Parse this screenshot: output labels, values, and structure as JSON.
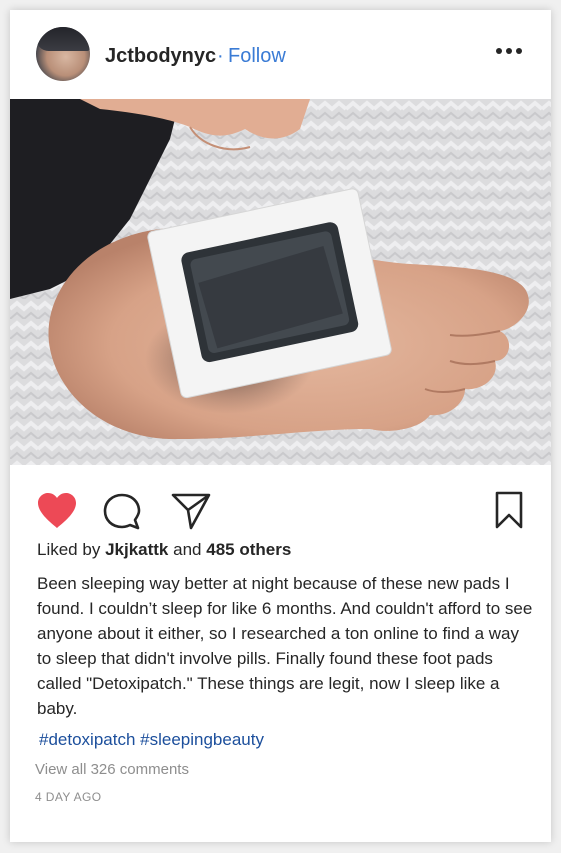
{
  "post": {
    "username": "Jctbodynyc",
    "separator": "·",
    "follow_label": "Follow",
    "liked_by_prefix": "Liked by",
    "liked_by_user": "Jkjkattk",
    "liked_by_and": "and",
    "liked_by_others": "485 others",
    "caption": "Been sleeping way better at night because of these new pads I found. I couldn’t sleep for like 6 months. And couldn't afford to see anyone about it either, so I researched a ton online to find a way to sleep that didn't involve pills. Finally found these foot pads called \"Detoxipatch.\" These things are legit, now I sleep like a baby.",
    "hashtags": [
      "#detoxipatch",
      "#sleepingbeauty"
    ],
    "view_comments": "View all 326 comments",
    "timestamp": "4 DAY AGO"
  },
  "icons": {
    "like": "heart-icon",
    "comment": "comment-bubble-icon",
    "share": "send-icon",
    "save": "bookmark-icon",
    "more": "more-options-icon"
  },
  "colors": {
    "like_active": "#ed4956",
    "follow": "#3a7bd5",
    "hashtag": "#1c4f9c",
    "muted": "#8e8e8e"
  }
}
